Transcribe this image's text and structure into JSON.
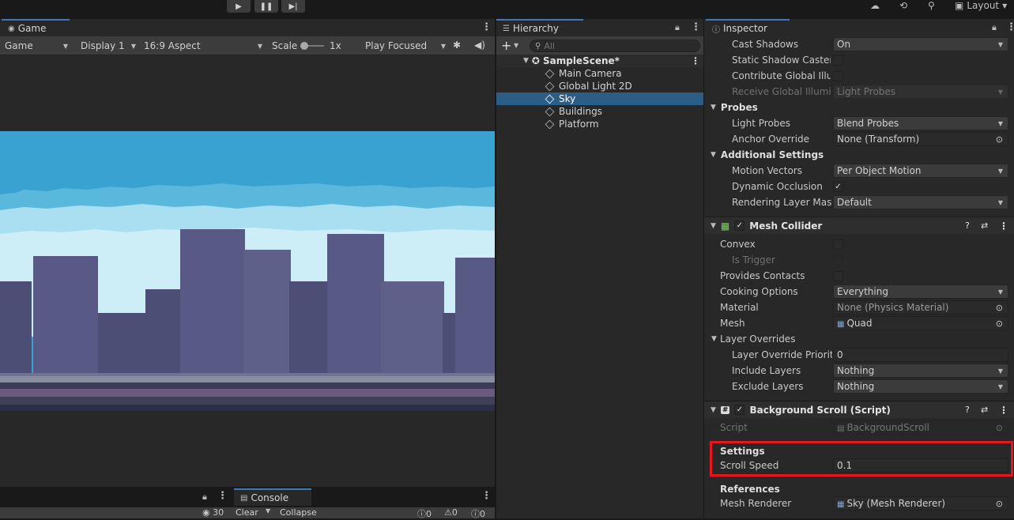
{
  "toolbar": {
    "play_icon": "play-icon",
    "pause_icon": "pause-icon",
    "step_icon": "step-icon",
    "layout_label": "Layout"
  },
  "game": {
    "tab_label": "Game",
    "view_select": "Game",
    "display_select": "Display 1",
    "aspect_select": "16:9 Aspect",
    "scale_label": "Scale",
    "scale_value": "1x",
    "play_mode_select": "Play Focused"
  },
  "console": {
    "tab_label": "Console",
    "visibility_count": "30",
    "clear_label": "Clear",
    "collapse_label": "Collapse",
    "log_count": "0",
    "warning_count": "0",
    "error_count": "0"
  },
  "hierarchy": {
    "tab_label": "Hierarchy",
    "search_placeholder": "All",
    "scene_name": "SampleScene*",
    "items": [
      {
        "label": "Main Camera"
      },
      {
        "label": "Global Light 2D"
      },
      {
        "label": "Sky"
      },
      {
        "label": "Buildings"
      },
      {
        "label": "Platform"
      }
    ]
  },
  "inspector": {
    "tab_label": "Inspector",
    "renderer": {
      "cast_shadows": {
        "label": "Cast Shadows",
        "value": "On"
      },
      "static_shadow_caster": {
        "label": "Static Shadow Caster"
      },
      "contribute_gi": {
        "label": "Contribute Global Illun"
      },
      "receive_gi": {
        "label": "Receive Global Illumina",
        "value": "Light Probes"
      },
      "probes_header": "Probes",
      "light_probes": {
        "label": "Light Probes",
        "value": "Blend Probes"
      },
      "anchor_override": {
        "label": "Anchor Override",
        "value": "None (Transform)"
      },
      "additional_header": "Additional Settings",
      "motion_vectors": {
        "label": "Motion Vectors",
        "value": "Per Object Motion"
      },
      "dynamic_occlusion": {
        "label": "Dynamic Occlusion"
      },
      "rendering_layer_mask": {
        "label": "Rendering Layer Mask",
        "value": "Default"
      }
    },
    "mesh_collider": {
      "title": "Mesh Collider",
      "convex": {
        "label": "Convex"
      },
      "is_trigger": {
        "label": "Is Trigger"
      },
      "provides_contacts": {
        "label": "Provides Contacts"
      },
      "cooking_options": {
        "label": "Cooking Options",
        "value": "Everything"
      },
      "material": {
        "label": "Material",
        "value": "None (Physics Material)"
      },
      "mesh": {
        "label": "Mesh",
        "value": "Quad"
      },
      "layer_overrides_header": "Layer Overrides",
      "layer_override_priority": {
        "label": "Layer Override Priority",
        "value": "0"
      },
      "include_layers": {
        "label": "Include Layers",
        "value": "Nothing"
      },
      "exclude_layers": {
        "label": "Exclude Layers",
        "value": "Nothing"
      }
    },
    "background_scroll": {
      "title": "Background Scroll (Script)",
      "script": {
        "label": "Script",
        "value": "BackgroundScroll"
      },
      "settings_header": "Settings",
      "scroll_speed": {
        "label": "Scroll Speed",
        "value": "0.1"
      },
      "references_header": "References",
      "mesh_renderer": {
        "label": "Mesh Renderer",
        "value": "Sky (Mesh Renderer)"
      }
    }
  },
  "colors": {
    "accent": "#3a79bb",
    "selection": "#2c5d87",
    "highlight_box": "#e8141e"
  }
}
